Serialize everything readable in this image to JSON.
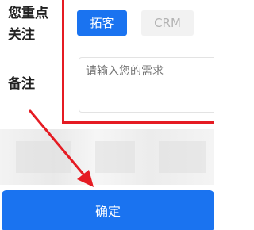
{
  "form": {
    "focus_label": "您重点关注",
    "focus_options": [
      "拓客",
      "CRM"
    ],
    "remark_label": "备注",
    "remark_placeholder": "请输入您的需求"
  },
  "footer": {
    "confirm_label": "确定"
  },
  "colors": {
    "primary": "#1a73f0",
    "annotation_red": "#e51b23",
    "chip_inactive_bg": "#f2f2f2",
    "placeholder": "#c0c0c0"
  }
}
